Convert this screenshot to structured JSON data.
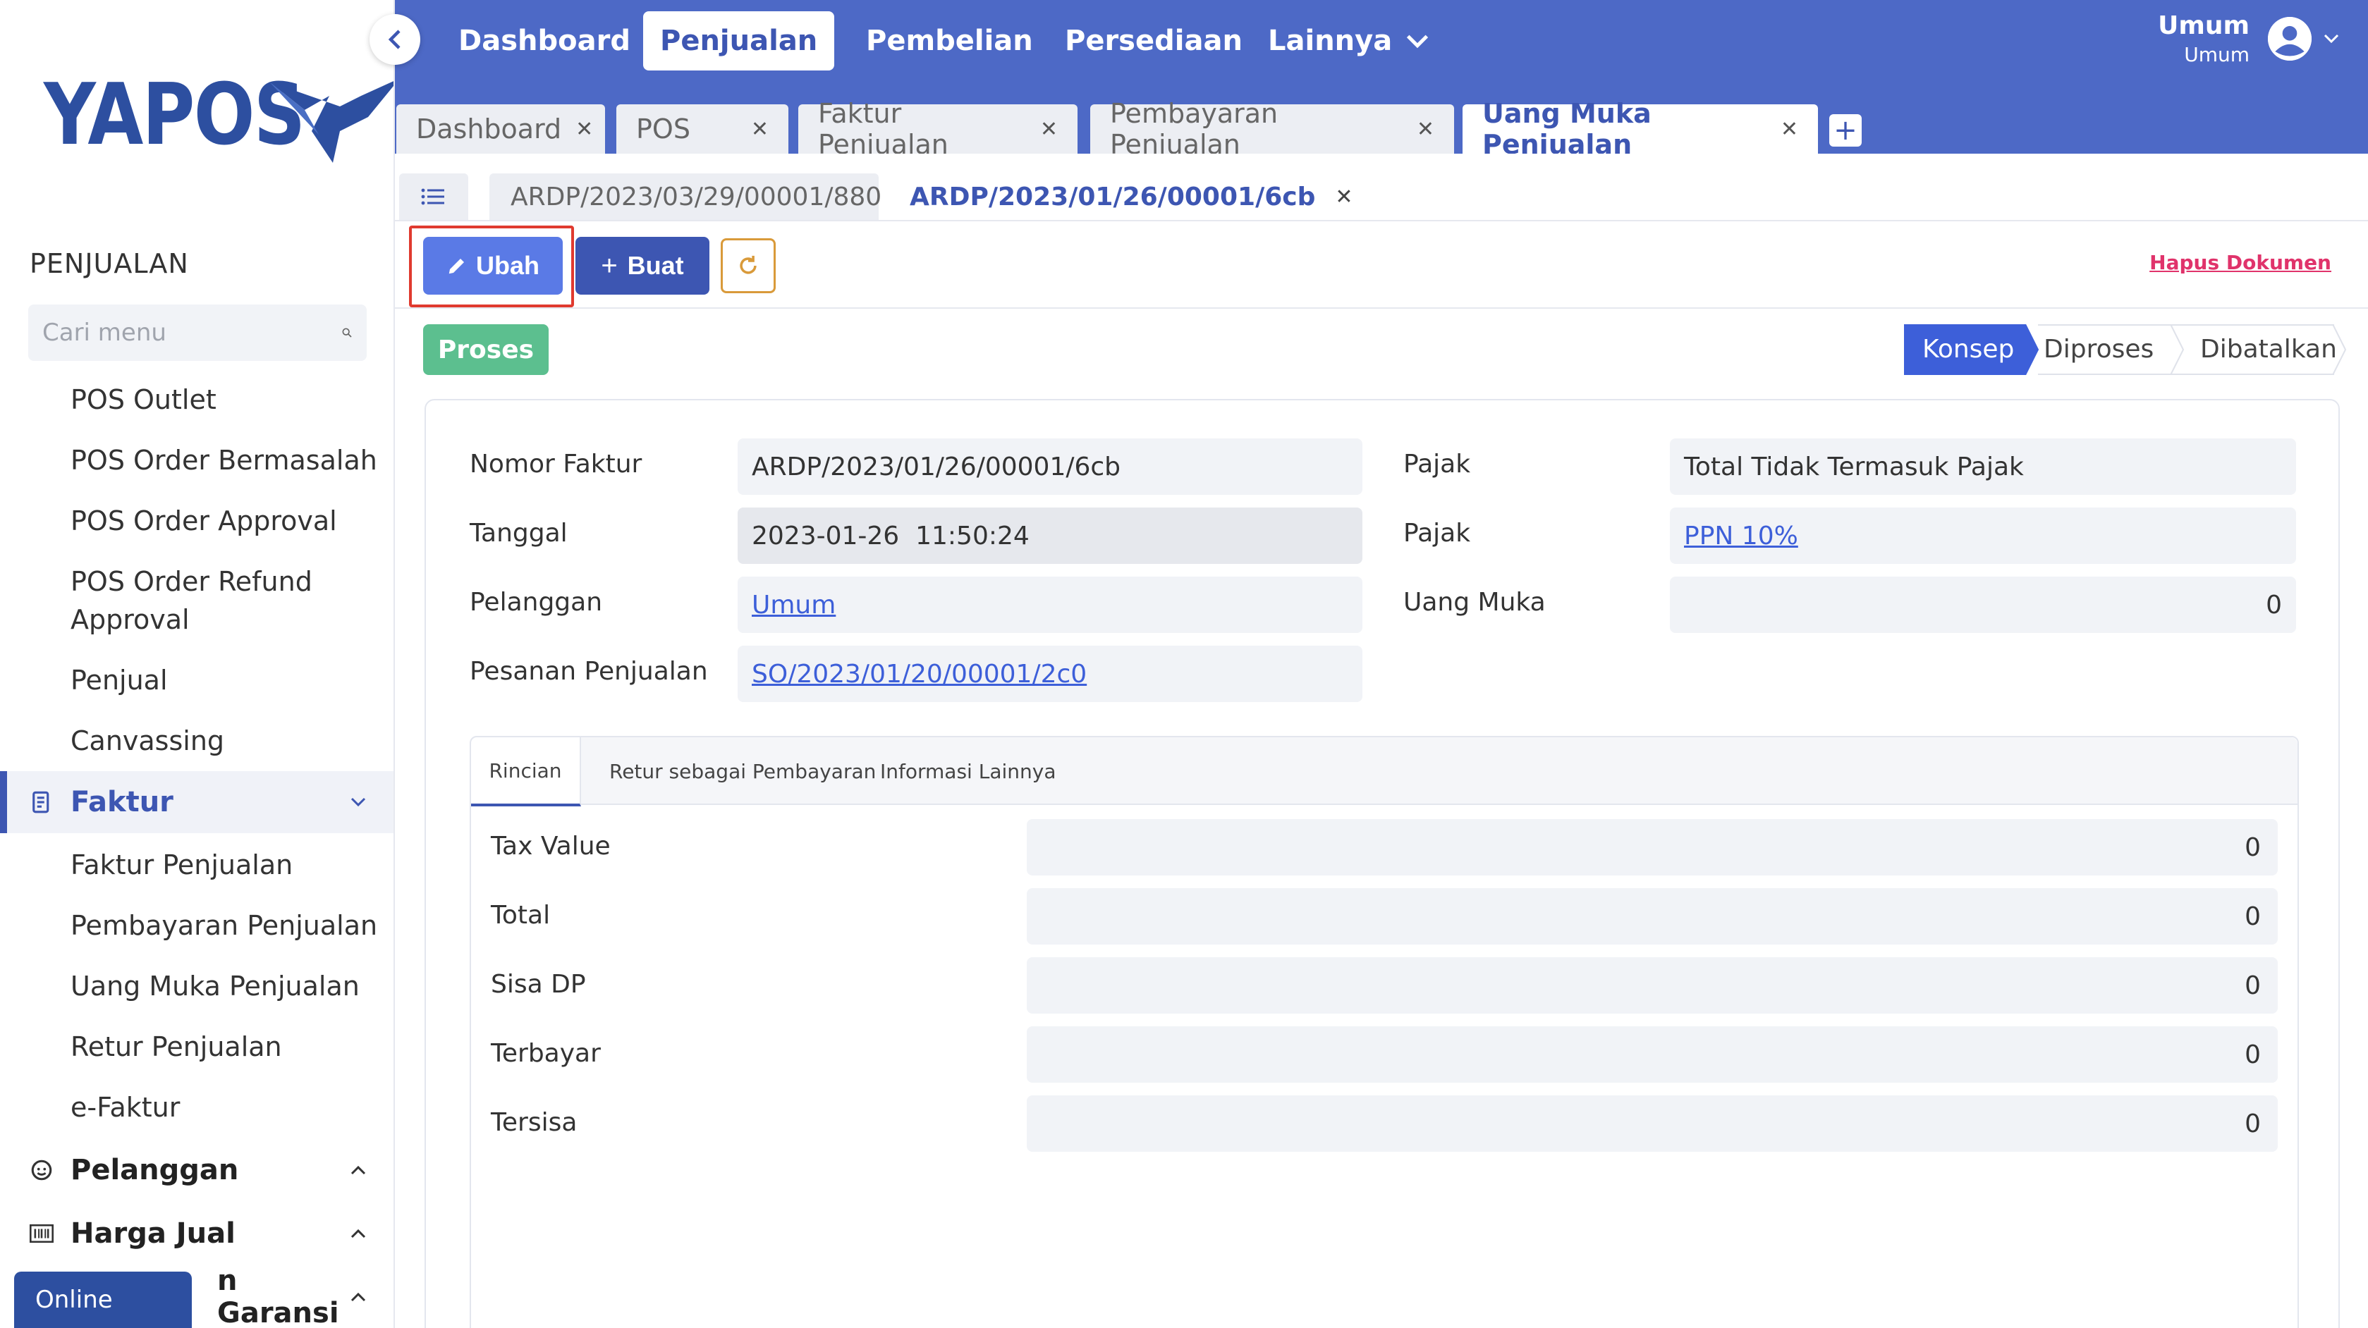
{
  "brand": {
    "name": "YAPOS"
  },
  "sidebar": {
    "section_title": "PENJUALAN",
    "search_placeholder": "Cari menu",
    "items_top": [
      "POS Outlet",
      "POS Order Bermasalah",
      "POS Order Approval",
      "POS Order Refund",
      "Approval",
      "Penjual",
      "Canvassing"
    ],
    "group_faktur": "Faktur",
    "items_faktur": [
      "Faktur Penjualan",
      "Pembayaran Penjualan",
      "Uang Muka Penjualan",
      "Retur Penjualan",
      "e-Faktur"
    ],
    "group_pelanggan": "Pelanggan",
    "group_harga": "Harga Jual",
    "group_garansi": "n Garansi",
    "online": "Online"
  },
  "topnav": {
    "items": [
      "Dashboard",
      "Penjualan",
      "Pembelian",
      "Persediaan",
      "Lainnya"
    ],
    "active": "Penjualan",
    "user_name": "Umum",
    "user_sub": "Umum"
  },
  "doc_tabs": [
    "Dashboard",
    "POS",
    "Faktur Penjualan",
    "Pembayaran Penjualan",
    "Uang Muka Penjualan"
  ],
  "record_tabs": [
    "ARDP/2023/03/29/00001/880",
    "ARDP/2023/01/26/00001/6cb"
  ],
  "toolbar": {
    "ubah": "Ubah",
    "buat": "Buat",
    "hapus": "Hapus Dokumen"
  },
  "status": {
    "proses": "Proses",
    "steps": [
      "Konsep",
      "Diproses",
      "Dibatalkan"
    ],
    "active_step": "Konsep"
  },
  "form": {
    "nomor_faktur_label": "Nomor Faktur",
    "nomor_faktur": "ARDP/2023/01/26/00001/6cb",
    "tanggal_label": "Tanggal",
    "tanggal": "2023-01-26  11:50:24",
    "pelanggan_label": "Pelanggan",
    "pelanggan": "Umum",
    "pesanan_label": "Pesanan Penjualan",
    "pesanan": "SO/2023/01/20/00001/2c0",
    "pajak_label": "Pajak",
    "pajak_mode": "Total Tidak Termasuk Pajak",
    "pajak2_label": "Pajak",
    "pajak_rate": "PPN 10%",
    "uang_muka_label": "Uang Muka",
    "uang_muka": "0"
  },
  "subtabs": [
    "Rincian",
    "Retur sebagai Pembayaran",
    "Informasi Lainnya"
  ],
  "rincian": [
    {
      "label": "Tax Value",
      "value": "0"
    },
    {
      "label": "Total",
      "value": "0"
    },
    {
      "label": "Sisa DP",
      "value": "0"
    },
    {
      "label": "Terbayar",
      "value": "0"
    },
    {
      "label": "Tersisa",
      "value": "0"
    }
  ],
  "colors": {
    "primary": "#4d69c6",
    "accent": "#3d56b2",
    "success": "#5cbf8f",
    "danger": "#e0336b"
  }
}
